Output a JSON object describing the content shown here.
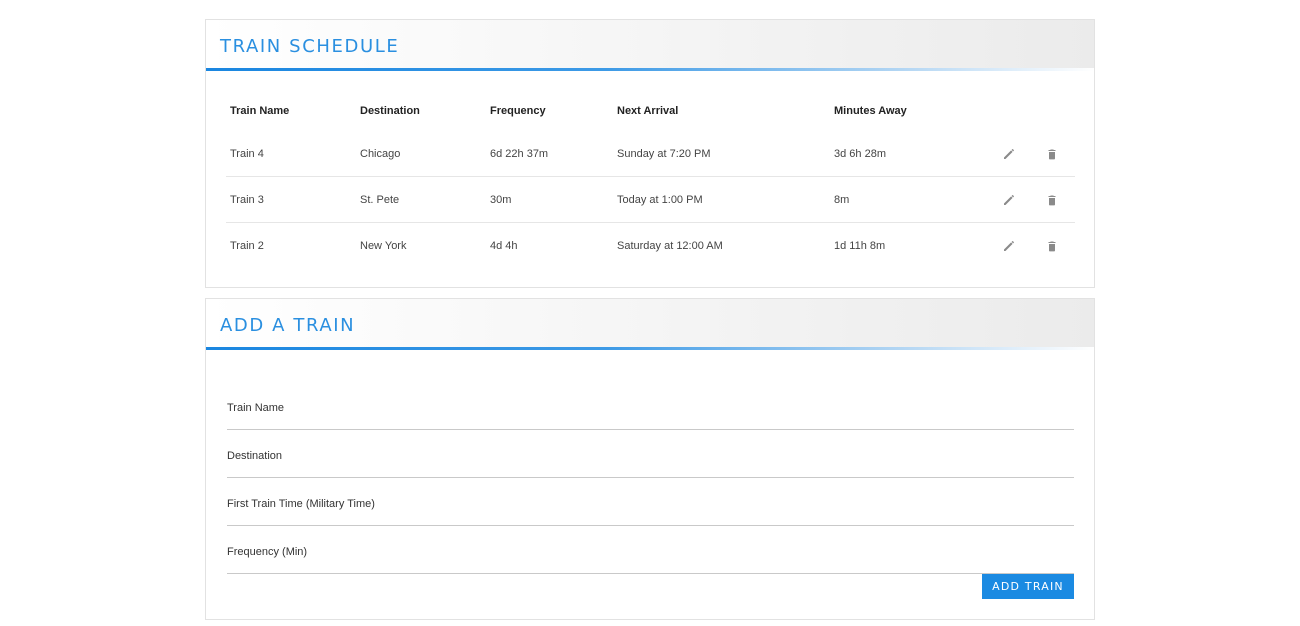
{
  "schedule": {
    "title": "TRAIN SCHEDULE",
    "headers": {
      "name": "Train Name",
      "destination": "Destination",
      "frequency": "Frequency",
      "next_arrival": "Next Arrival",
      "minutes_away": "Minutes Away"
    },
    "rows": [
      {
        "name": "Train 4",
        "destination": "Chicago",
        "frequency": "6d 22h 37m",
        "next_arrival": "Sunday at 7:20 PM",
        "minutes_away": "3d 6h 28m"
      },
      {
        "name": "Train 3",
        "destination": "St. Pete",
        "frequency": "30m",
        "next_arrival": "Today at 1:00 PM",
        "minutes_away": "8m"
      },
      {
        "name": "Train 2",
        "destination": "New York",
        "frequency": "4d 4h",
        "next_arrival": "Saturday at 12:00 AM",
        "minutes_away": "1d 11h 8m"
      }
    ],
    "icons": {
      "edit": "pencil-icon",
      "delete": "trash-icon"
    }
  },
  "add_train": {
    "title": "ADD A TRAIN",
    "fields": {
      "name": {
        "placeholder": "Train Name",
        "value": ""
      },
      "destination": {
        "placeholder": "Destination",
        "value": ""
      },
      "first_time": {
        "placeholder": "First Train Time (Military Time)",
        "value": ""
      },
      "frequency": {
        "placeholder": "Frequency (Min)",
        "value": ""
      }
    },
    "submit_label": "ADD TRAIN"
  },
  "colors": {
    "accent": "#2a8fe0",
    "button": "#1b8ae2",
    "icon": "#8a8a8a"
  }
}
